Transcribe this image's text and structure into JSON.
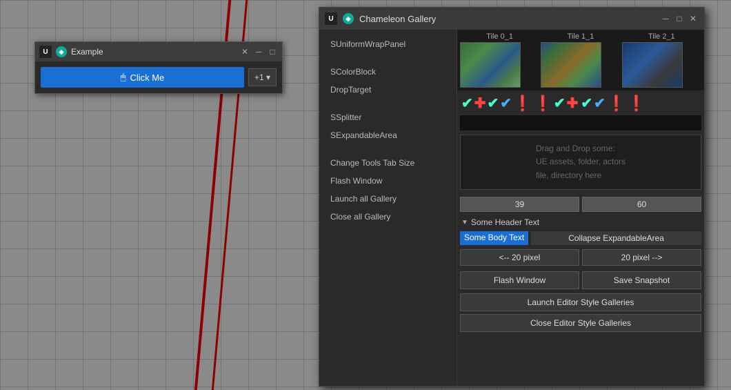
{
  "background": {
    "color": "#7a7a7a"
  },
  "example_window": {
    "title": "Example",
    "close_btn": "✕",
    "minimize_btn": "─",
    "maximize_btn": "□",
    "click_btn_label": "Click Me",
    "plus_one_label": "+1 ▾"
  },
  "gallery_window": {
    "title": "Chameleon Gallery",
    "close_btn": "✕",
    "minimize_btn": "─",
    "maximize_btn": "□",
    "sidebar": {
      "items": [
        {
          "label": "SUniformWrapPanel"
        },
        {
          "label": ""
        },
        {
          "label": "SColorBlock"
        },
        {
          "label": "DropTarget"
        },
        {
          "label": ""
        },
        {
          "label": "SSplitter"
        },
        {
          "label": "SExpandableArea"
        },
        {
          "label": ""
        },
        {
          "label": "Change Tools Tab Size"
        },
        {
          "label": "Flash Window"
        },
        {
          "label": "Launch all Gallery"
        },
        {
          "label": "Close all Gallery"
        }
      ]
    },
    "tiles": [
      {
        "label": "Tile 0_1"
      },
      {
        "label": "Tile 1_1"
      },
      {
        "label": "Tile 2_1"
      }
    ],
    "icons": [
      "✔",
      "✚",
      "✔",
      "✔",
      "❗",
      "❗",
      "✔",
      "✚",
      "✔",
      "✔",
      "❗",
      "❗"
    ],
    "drop_area": {
      "line1": "Drag and Drop some:",
      "line2": "  UE assets, folder, actors",
      "line3": "file, directory here"
    },
    "splitter": {
      "val1": "39",
      "val2": "60"
    },
    "expandable": {
      "header": "Some Header Text",
      "body_text": "Some Body Text",
      "collapse_btn": "Collapse ExpandableArea"
    },
    "tool_buttons": [
      {
        "label": "<-- 20 pixel"
      },
      {
        "label": "20 pixel -->"
      }
    ],
    "action_buttons_row": [
      {
        "label": "Flash Window"
      },
      {
        "label": "Save Snapshot"
      }
    ],
    "launch_btn": "Launch Editor Style Galleries",
    "close_btn_gallery": "Close Editor Style Galleries"
  }
}
